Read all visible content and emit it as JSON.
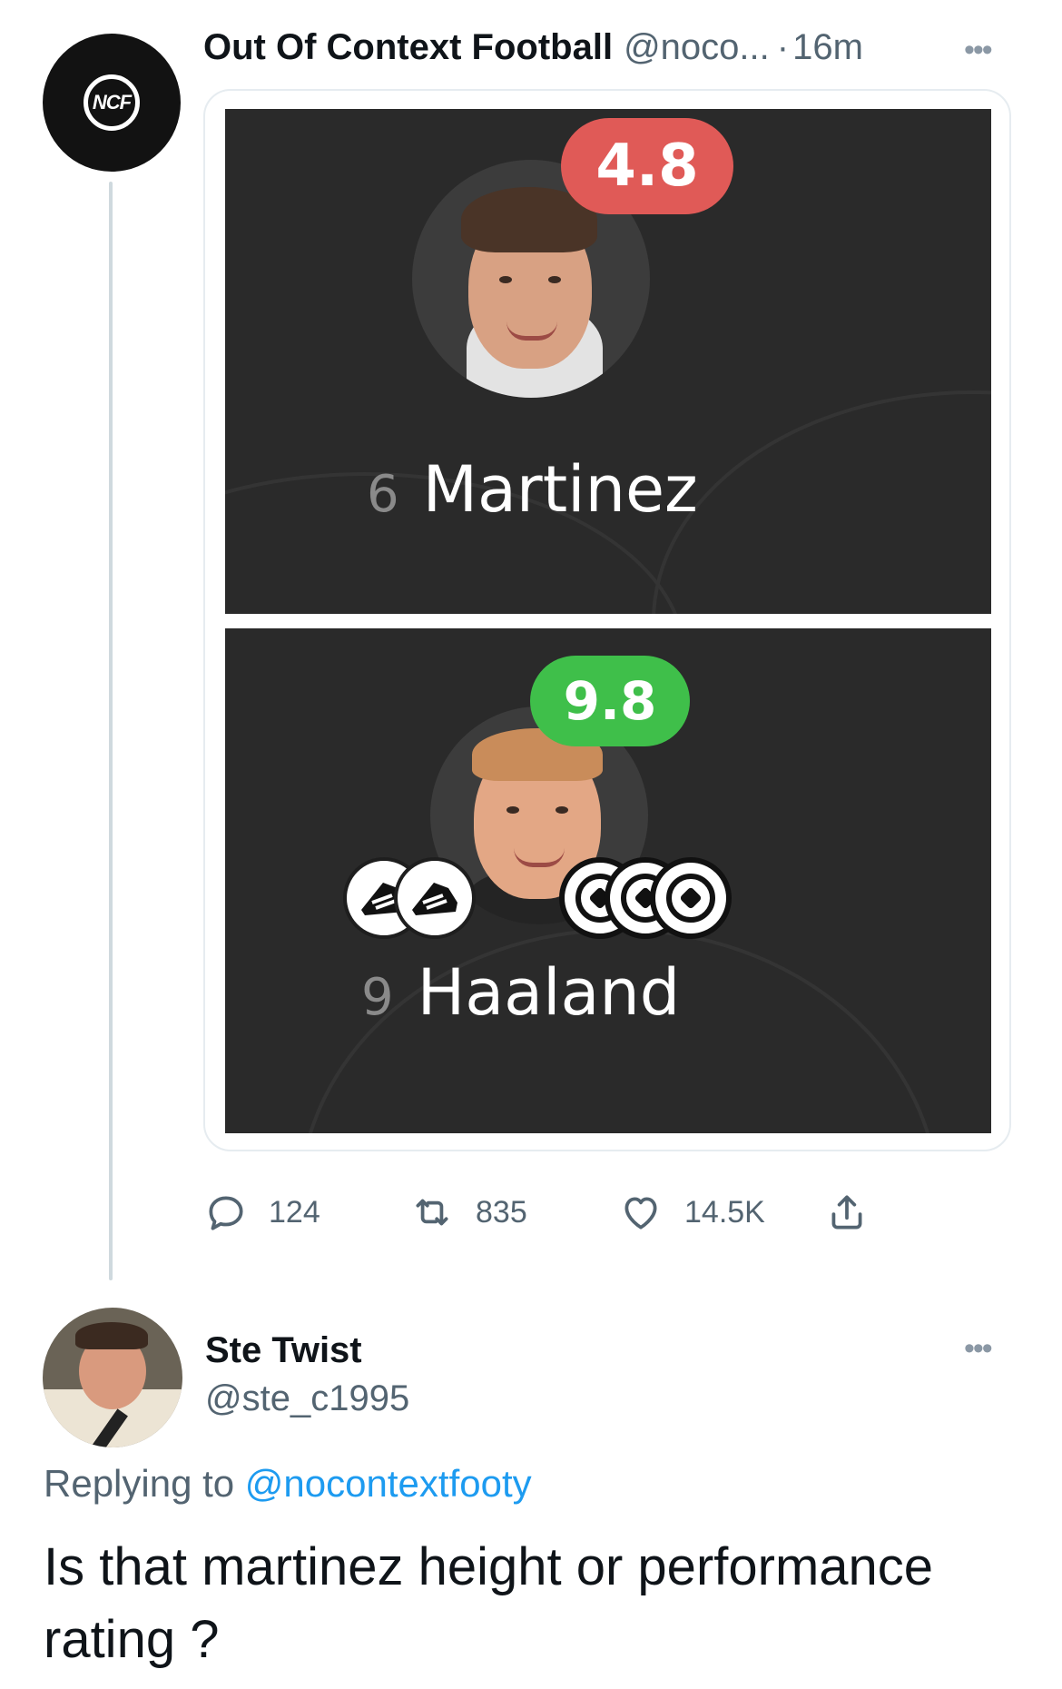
{
  "tweet": {
    "avatar_text": "NCF",
    "display_name": "Out Of Context Football",
    "handle": "@noco...",
    "separator": "·",
    "time": "16m",
    "more": "•••",
    "media": {
      "players": [
        {
          "rating": "4.8",
          "rating_color": "#e05a57",
          "number": "6",
          "name": "Martinez"
        },
        {
          "rating": "9.8",
          "rating_color": "#3fbf4a",
          "number": "9",
          "name": "Haaland",
          "assists": 2,
          "goals": 3
        }
      ]
    },
    "actions": {
      "replies": "124",
      "retweets": "835",
      "likes": "14.5K"
    }
  },
  "reply": {
    "display_name": "Ste Twist",
    "handle": "@ste_c1995",
    "more": "•••",
    "replying_prefix": "Replying to",
    "replying_to": "@nocontextfooty",
    "text": "Is that martinez height or performance rating ?"
  }
}
